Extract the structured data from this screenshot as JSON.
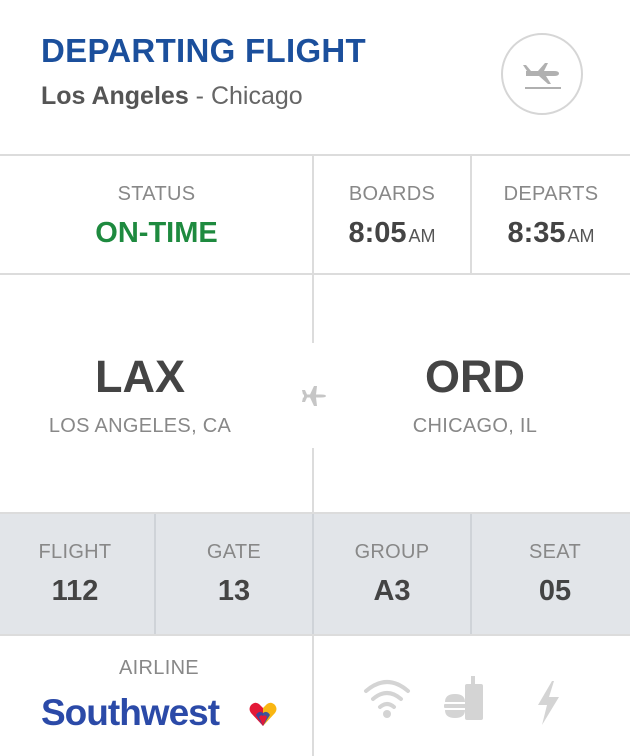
{
  "header": {
    "title": "DEPARTING FLIGHT",
    "origin_city": "Los Angeles",
    "separator": " - ",
    "destination_city": "Chicago",
    "icon": "plane-departure-icon"
  },
  "times": {
    "status_label": "STATUS",
    "status_value": "ON-TIME",
    "boards_label": "BOARDS",
    "boards_time": "8:05",
    "boards_ampm": "AM",
    "departs_label": "DEPARTS",
    "departs_time": "8:35",
    "departs_ampm": "AM"
  },
  "route": {
    "origin_code": "LAX",
    "origin_city": "LOS ANGELES, CA",
    "destination_code": "ORD",
    "destination_city": "CHICAGO, IL",
    "icon": "plane-icon"
  },
  "details": {
    "flight_label": "FLIGHT",
    "flight_value": "112",
    "gate_label": "GATE",
    "gate_value": "13",
    "group_label": "GROUP",
    "group_value": "A3",
    "seat_label": "SEAT",
    "seat_value": "05"
  },
  "airline": {
    "label": "AIRLINE",
    "name": "Southwest"
  },
  "amenities": [
    "wifi-icon",
    "food-drink-icon",
    "power-icon"
  ],
  "colors": {
    "title_blue": "#1b4f9c",
    "status_green": "#1e8a3f",
    "band_gray": "#e2e5e9",
    "southwest_blue": "#2b4aa8",
    "heart_red": "#e31837",
    "heart_yellow": "#f9b612"
  }
}
